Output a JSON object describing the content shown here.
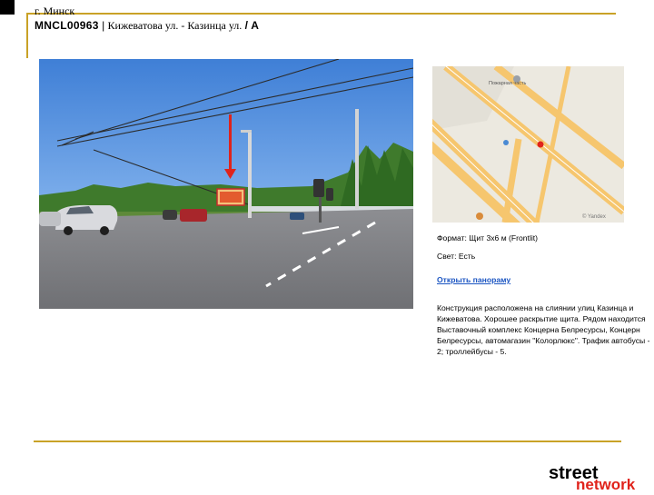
{
  "header": {
    "city": "г. Минск",
    "code": "MNCL00963",
    "separator": " | ",
    "address": "Кижеватова ул. - Казинца ул.",
    "side": " / А"
  },
  "map": {
    "poi_label": "Пожарная часть",
    "copyright": "© Yandex"
  },
  "info": {
    "format": "Формат: Щит 3х6 м (Frontlit)",
    "light": "Свет: Есть",
    "panorama_link": "Открыть панораму",
    "description": "Конструкция расположена на слиянии улиц Казинца и Кижеватова. Хорошее раскрытие щита. Рядом находится Выставочный комплекс Концерна Белресурсы, Концерн Белресурсы, автомагазин \"Колорлюкс\". Трафик автобусы - 2; троллейбусы - 5."
  },
  "logo": {
    "line1": "street",
    "line2": "network"
  },
  "colors": {
    "accent_line": "#c9a227",
    "link": "#1b55c2",
    "arrow": "#e0231b",
    "logo_red": "#e0231b"
  }
}
